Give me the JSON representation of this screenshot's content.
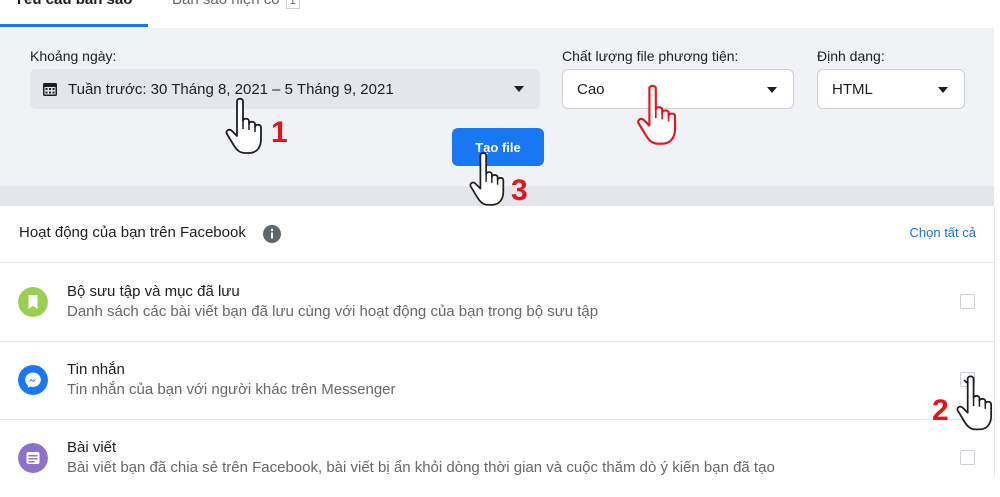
{
  "tabs": [
    {
      "label": "Yêu cầu bản sao",
      "active": true
    },
    {
      "label": "Bản sao hiện có",
      "count": "1",
      "active": false
    }
  ],
  "settings": {
    "date_range": {
      "label": "Khoảng ngày:",
      "value": "Tuần trước: 30 Tháng 8, 2021 – 5 Tháng 9, 2021",
      "icon": "calendar-icon"
    },
    "media_quality": {
      "label": "Chất lượng file phương tiện:",
      "value": "Cao"
    },
    "format": {
      "label": "Định dạng:",
      "value": "HTML"
    },
    "create_button": "Tạo file"
  },
  "activity": {
    "title": "Hoạt động của bạn trên Facebook",
    "select_all": "Chọn tất cả",
    "items": [
      {
        "title": "Bộ sưu tập và mục đã lưu",
        "description": "Danh sách các bài viết bạn đã lưu cùng với hoạt động của bạn trong bộ sưu tập",
        "icon": "bookmark-icon",
        "color": "#9bcf53",
        "checked": false
      },
      {
        "title": "Tin nhắn",
        "description": "Tin nhắn của bạn với người khác trên Messenger",
        "icon": "messenger-icon",
        "color": "#1877f2",
        "checked": true
      },
      {
        "title": "Bài viết",
        "description": "Bài viết bạn đã chia sẻ trên Facebook, bài viết bị ẩn khỏi dòng thời gian và cuộc thăm dò ý kiến bạn đã tạo",
        "icon": "post-icon",
        "color": "#8c72cb",
        "checked": false
      }
    ]
  },
  "annotations": {
    "step1": "1",
    "step2": "2",
    "step3": "3",
    "color": "#e4141b"
  }
}
